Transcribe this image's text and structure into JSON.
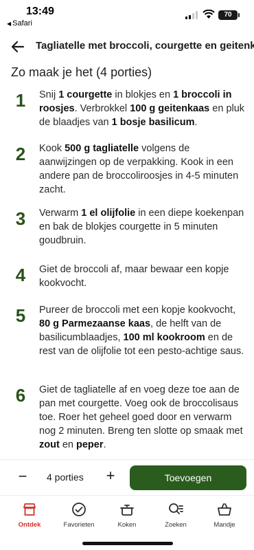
{
  "status_bar": {
    "time": "13:49",
    "back_app": "Safari",
    "battery": "70"
  },
  "header": {
    "back_icon": "arrow-left-icon",
    "title": "Tagliatelle met broccoli, courgette en geitenkaas"
  },
  "section_title": "Zo maak je het (4 porties)",
  "steps": [
    {
      "number": "1",
      "segments": [
        {
          "text": "Snij ",
          "bold": false
        },
        {
          "text": "1 courgette",
          "bold": true
        },
        {
          "text": " in blokjes en ",
          "bold": false
        },
        {
          "text": "1 broccoli in roosjes",
          "bold": true
        },
        {
          "text": ". Verbrokkel ",
          "bold": false
        },
        {
          "text": "100 g geitenkaas",
          "bold": true
        },
        {
          "text": " en pluk de blaadjes van ",
          "bold": false
        },
        {
          "text": "1 bosje basilicum",
          "bold": true
        },
        {
          "text": ".",
          "bold": false
        }
      ]
    },
    {
      "number": "2",
      "segments": [
        {
          "text": "Kook ",
          "bold": false
        },
        {
          "text": "500 g tagliatelle",
          "bold": true
        },
        {
          "text": " volgens de aanwijzingen op de verpakking. Kook in een andere pan de broccoliroosjes in 4-5 minuten zacht.",
          "bold": false
        }
      ]
    },
    {
      "number": "3",
      "segments": [
        {
          "text": "Verwarm ",
          "bold": false
        },
        {
          "text": "1 el olijfolie",
          "bold": true
        },
        {
          "text": " in een diepe koekenpan en bak de blokjes courgette in 5 minuten goudbruin.",
          "bold": false
        }
      ]
    },
    {
      "number": "4",
      "segments": [
        {
          "text": "Giet de broccoli af, maar bewaar een kopje kookvocht.",
          "bold": false
        }
      ]
    },
    {
      "number": "5",
      "segments": [
        {
          "text": "Pureer de broccoli met een kopje kookvocht, ",
          "bold": false
        },
        {
          "text": "80 g Parmezaanse kaas",
          "bold": true
        },
        {
          "text": ", de helft van de basilicumblaadjes, ",
          "bold": false
        },
        {
          "text": "100 ml kookroom",
          "bold": true
        },
        {
          "text": " en de rest van de olijfolie tot een pesto-achtige saus.",
          "bold": false
        }
      ]
    },
    {
      "number": "6",
      "segments": [
        {
          "text": "Giet de tagliatelle af en voeg deze toe aan de pan met courgette. Voeg ook de broccolisaus toe. Roer het geheel goed door en verwarm nog 2 minuten. Breng ten slotte op smaak met ",
          "bold": false
        },
        {
          "text": "zout",
          "bold": true
        },
        {
          "text": " en ",
          "bold": false
        },
        {
          "text": "peper",
          "bold": true
        },
        {
          "text": ".",
          "bold": false
        }
      ]
    }
  ],
  "order_bar": {
    "minus": "−",
    "portions_label": "4 porties",
    "plus": "+",
    "add_label": "Toevoegen",
    "accent_color": "#2a5c1e"
  },
  "tabs": [
    {
      "label": "Ontdek",
      "icon": "shop-icon",
      "active": true
    },
    {
      "label": "Favorieten",
      "icon": "checkmark-circle-icon",
      "active": false
    },
    {
      "label": "Koken",
      "icon": "cooking-pot-icon",
      "active": false
    },
    {
      "label": "Zoeken",
      "icon": "search-list-icon",
      "active": false
    },
    {
      "label": "Mandje",
      "icon": "basket-icon",
      "active": false
    }
  ],
  "colors": {
    "step_number": "#2a5218",
    "active_tab": "#d0302a"
  }
}
